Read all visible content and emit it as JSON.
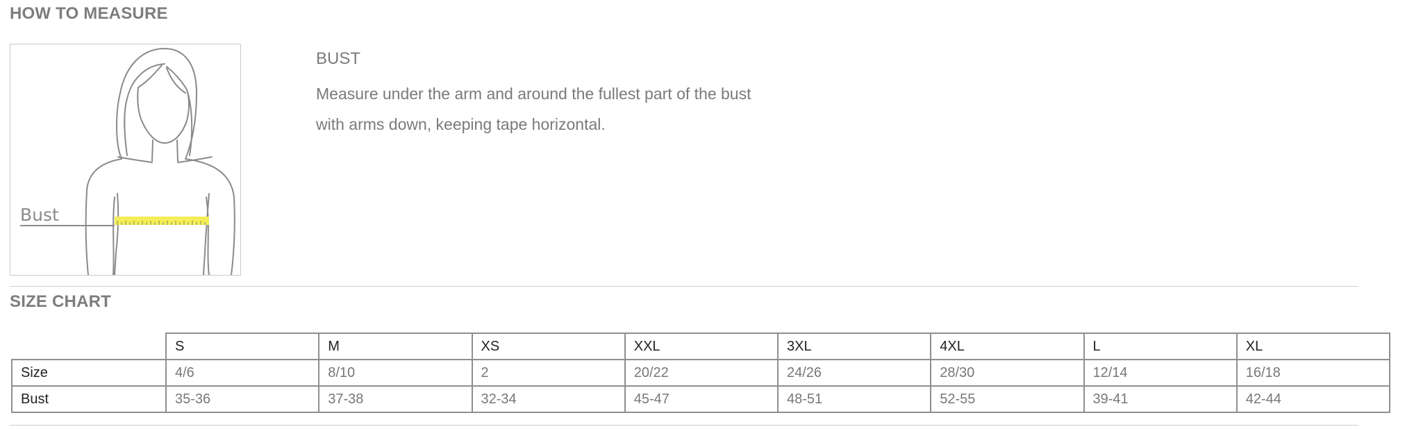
{
  "how_to_measure": {
    "heading": "HOW TO MEASURE",
    "figure_label": "Bust",
    "bust_title": "BUST",
    "bust_desc_line1": "Measure under the arm and around the fullest part of the bust",
    "bust_desc_line2": "with arms down, keeping tape horizontal."
  },
  "size_chart": {
    "heading": "SIZE CHART",
    "columns": [
      "S",
      "M",
      "XS",
      "XXL",
      "3XL",
      "4XL",
      "L",
      "XL"
    ],
    "rows": [
      {
        "label": "Size",
        "values": [
          "4/6",
          "8/10",
          "2",
          "20/22",
          "24/26",
          "28/30",
          "12/14",
          "16/18"
        ]
      },
      {
        "label": "Bust",
        "values": [
          "35-36",
          "37-38",
          "32-34",
          "45-47",
          "48-51",
          "52-55",
          "39-41",
          "42-44"
        ]
      }
    ]
  },
  "colors": {
    "tape": "#f3ee57",
    "text": "#7a7a7a",
    "border": "#8f8f8f"
  }
}
